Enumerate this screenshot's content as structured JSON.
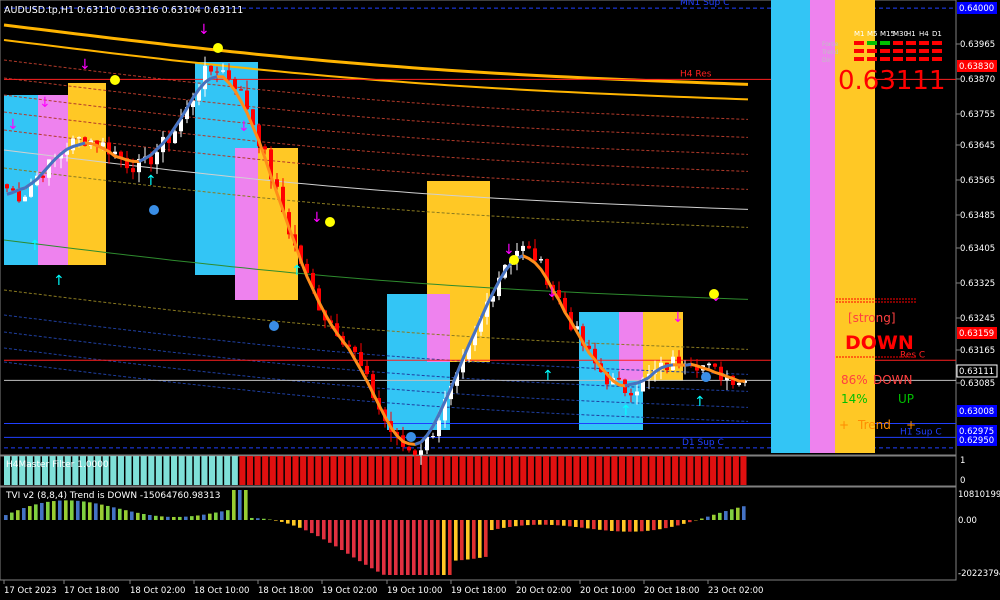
{
  "symbol_header": "AUDUSD.tp,H1  0.63110 0.63116 0.63104 0.63111",
  "colors": {
    "background": "#000000",
    "bull_candle": "#ffffff",
    "bear_candle": "#ff0000",
    "box_blue": "#33c5f5",
    "box_pink": "#ee82ee",
    "box_gold": "#ffc825",
    "orange_ma": "#ff8c1a",
    "blue_ma": "#4472c4",
    "band_upper": "#ffb400",
    "band_red": "#b23a2a",
    "band_lower": "#1f3fa0",
    "green_ma": "#2e8b2e",
    "accent_red": "#ff0000",
    "accent_cyan": "#00ffff",
    "accent_magenta": "#ff00ff",
    "accent_yellow": "#ffff00"
  },
  "price_axis": {
    "ticks": [
      "0.63965",
      "0.63870",
      "0.63755",
      "0.63645",
      "0.63565",
      "0.63485",
      "0.63405",
      "0.63325",
      "0.63245",
      "0.63165",
      "0.63085"
    ],
    "labels_boxed": [
      {
        "text": "0.63830",
        "bg": "#ff0000",
        "fg": "#ffffff",
        "price": 0.6383
      },
      {
        "text": "0.63159",
        "bg": "#ff0000",
        "fg": "#ffffff",
        "price": 0.63159
      },
      {
        "text": "0.63111",
        "bg": "#000000",
        "fg": "#ffffff",
        "border": "#ffffff",
        "price": 0.63111
      },
      {
        "text": "0.63008",
        "bg": "#0000ff",
        "fg": "#ffffff",
        "price": 0.63008
      },
      {
        "text": "0.62975",
        "bg": "#0000ff",
        "fg": "#ffffff",
        "price": 0.62975
      },
      {
        "text": "0.62950",
        "bg": "#0000ff",
        "fg": "#ffffff",
        "price": 0.6295
      },
      {
        "text": "0.64000",
        "bg": "#0000ff",
        "fg": "#ffffff",
        "price": 0.64
      }
    ]
  },
  "levels": [
    {
      "label": "MN1 Sup C",
      "price": 0.64,
      "color": "#2040ff"
    },
    {
      "label": "H4 Res",
      "price": 0.6383,
      "color": "#ff2020"
    },
    {
      "label": "Res C",
      "price": 0.63159,
      "color": "#ff2020"
    },
    {
      "label": "H1 Sup",
      "price": 0.63008,
      "color": "#2040ff"
    },
    {
      "label": "H1 Sup C",
      "price": 0.62975,
      "color": "#2040ff"
    },
    {
      "label": "D1 Sup C",
      "price": 0.6295,
      "color": "#2040ff"
    }
  ],
  "dashboard": {
    "timeframes": [
      "M1",
      "M5",
      "M15",
      "M30",
      "H1",
      "H4",
      "D1"
    ],
    "rows": [
      "Force",
      "Trend",
      "Dir"
    ],
    "big_price": "0.63111",
    "strong_label": "[strong]",
    "direction": "DOWN",
    "pct_down": "86%",
    "pct_down_label": "DOWN",
    "pct_up": "14%",
    "pct_up_label": "UP",
    "trend_label": "Trend",
    "trend_plus": "+",
    "stripes": [
      "#33c5f5",
      "#ee82ee",
      "#ffc825"
    ]
  },
  "subwindow1": {
    "title": "H4Master Filter 1.0000",
    "axis": [
      "1",
      "0"
    ],
    "cyan_bars": 31,
    "red_bars": 67
  },
  "subwindow2": {
    "title": "TVI v2 (8,8,4) Trend is DOWN -15064760.98313",
    "axis": [
      "10810199",
      "0.00",
      "-20223794"
    ]
  },
  "time_axis": [
    "17 Oct 2023",
    "17 Oct 18:00",
    "18 Oct 02:00",
    "18 Oct 10:00",
    "18 Oct 18:00",
    "19 Oct 02:00",
    "19 Oct 10:00",
    "19 Oct 18:00",
    "20 Oct 02:00",
    "20 Oct 10:00",
    "20 Oct 18:00",
    "23 Oct 02:00"
  ],
  "chart_data": {
    "type": "candlestick",
    "title": "AUDUSD.tp,H1",
    "ohlc_summary": {
      "open": 0.6311,
      "high": 0.63116,
      "low": 0.63104,
      "close": 0.63111
    },
    "close_path": [
      0.6357,
      0.6355,
      0.636,
      0.6363,
      0.6367,
      0.6369,
      0.6368,
      0.6366,
      0.6363,
      0.6362,
      0.6366,
      0.637,
      0.6376,
      0.6384,
      0.6386,
      0.6383,
      0.6376,
      0.6366,
      0.6355,
      0.6344,
      0.6335,
      0.6327,
      0.6323,
      0.6318,
      0.631,
      0.6302,
      0.6296,
      0.6294,
      0.6297,
      0.6305,
      0.6312,
      0.6321,
      0.6331,
      0.6339,
      0.6343,
      0.6341,
      0.6335,
      0.6328,
      0.6321,
      0.6315,
      0.6311,
      0.6309,
      0.631,
      0.6313,
      0.6315,
      0.6317,
      0.6315,
      0.6313,
      0.6312,
      0.6311
    ]
  }
}
